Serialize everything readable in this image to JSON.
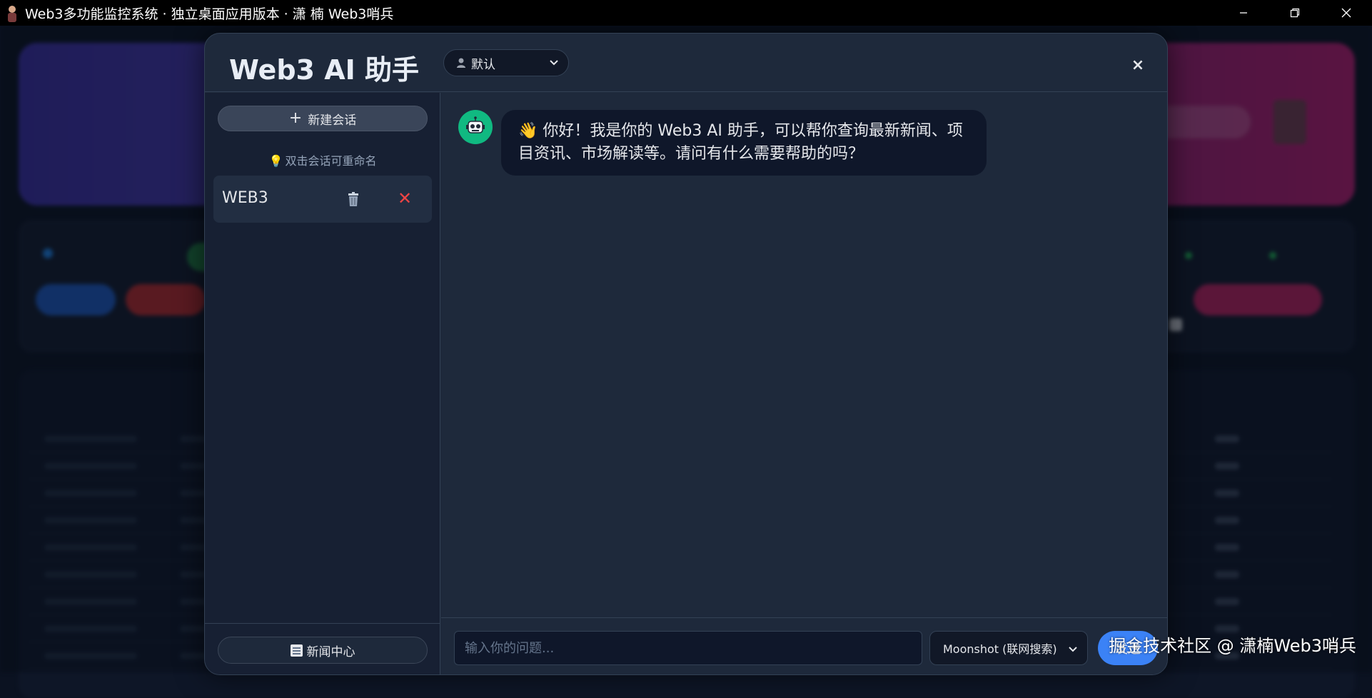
{
  "window": {
    "title": "Web3多功能监控系统 · 独立桌面应用版本 · 潇 楠 Web3哨兵",
    "controls": [
      "minimize",
      "restore",
      "close"
    ]
  },
  "modal": {
    "title": "Web3 AI 助手",
    "persona_select": {
      "selected": "默认",
      "icon": "person-icon"
    },
    "close_label": "×"
  },
  "sidebar": {
    "new_chat_label": "新建会话",
    "hint": "双击会话可重命名",
    "sessions": [
      {
        "name": "WEB3"
      }
    ],
    "news_center_label": "新闻中心"
  },
  "chat": {
    "messages": [
      {
        "role": "assistant",
        "avatar_icon": "robot-icon",
        "text": "👋 你好！我是你的 Web3 AI 助手，可以帮你查询最新新闻、项目资讯、市场解读等。请问有什么需要帮助的吗？"
      }
    ],
    "input": {
      "placeholder": "输入你的问题...",
      "value": ""
    },
    "model_select": {
      "selected": "Moonshot (联网搜索)"
    },
    "send_label": "发送"
  },
  "watermark": "掘金技术社区 @ 潇楠Web3哨兵",
  "colors": {
    "modal_bg": "#1e293b",
    "sidebar_bg": "#172033",
    "bot_avatar": "#10b981",
    "send_button": "#3b82f6",
    "delete_x": "#ef4444"
  }
}
